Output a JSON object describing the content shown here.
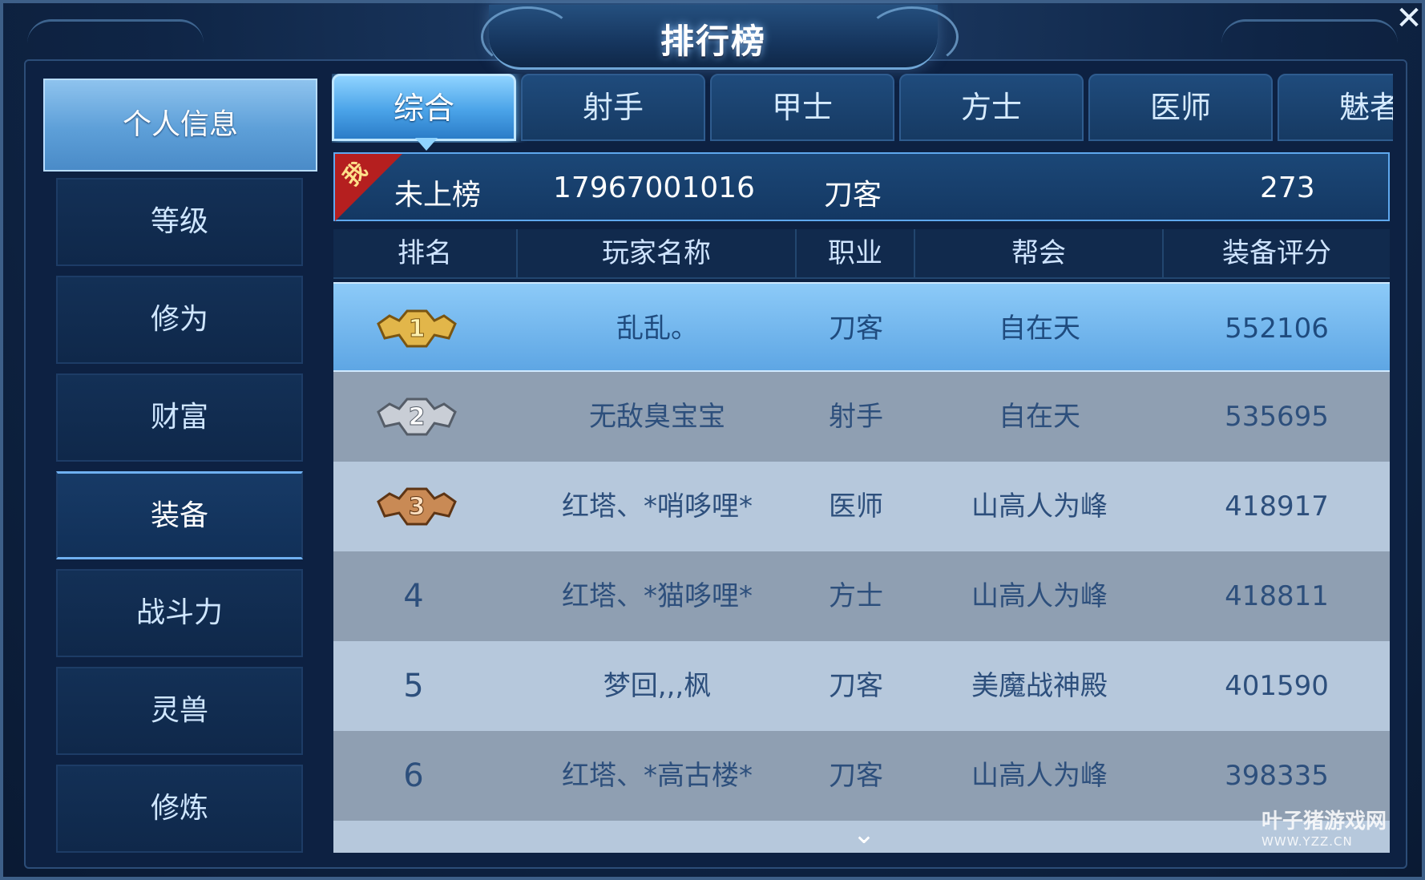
{
  "title": "排行榜",
  "sidebar": {
    "items": [
      {
        "label": "个人信息"
      },
      {
        "label": "等级"
      },
      {
        "label": "修为"
      },
      {
        "label": "财富"
      },
      {
        "label": "装备"
      },
      {
        "label": "战斗力"
      },
      {
        "label": "灵兽"
      },
      {
        "label": "修炼"
      }
    ]
  },
  "tabs": [
    {
      "label": "综合"
    },
    {
      "label": "射手"
    },
    {
      "label": "甲士"
    },
    {
      "label": "方士"
    },
    {
      "label": "医师"
    },
    {
      "label": "魅者"
    }
  ],
  "my_rank": {
    "badge": "我",
    "rank": "未上榜",
    "name": "17967001016",
    "class": "刀客",
    "score": "273"
  },
  "table": {
    "headers": [
      "排名",
      "玩家名称",
      "职业",
      "帮会",
      "装备评分"
    ],
    "rows": [
      {
        "rank": "1",
        "name": "乱乱。",
        "class": "刀客",
        "guild": "自在天",
        "score": "552106"
      },
      {
        "rank": "2",
        "name": "无敌臭宝宝",
        "class": "射手",
        "guild": "自在天",
        "score": "535695"
      },
      {
        "rank": "3",
        "name": "红塔、*哨哆哩*",
        "class": "医师",
        "guild": "山高人为峰",
        "score": "418917"
      },
      {
        "rank": "4",
        "name": "红塔、*猫哆哩*",
        "class": "方士",
        "guild": "山高人为峰",
        "score": "418811"
      },
      {
        "rank": "5",
        "name": "梦回,,,枫",
        "class": "刀客",
        "guild": "美魔战神殿",
        "score": "401590"
      },
      {
        "rank": "6",
        "name": "红塔、*高古楼*",
        "class": "刀客",
        "guild": "山高人为峰",
        "score": "398335"
      }
    ]
  },
  "watermark": {
    "main": "叶子猪游戏网",
    "sub": "WWW.YZZ.CN"
  },
  "colors": {
    "accent": "#5ea6e4",
    "panel": "#0d2142",
    "gold": "#e2b64a",
    "silver": "#c9ced6",
    "bronze": "#c98a55"
  }
}
